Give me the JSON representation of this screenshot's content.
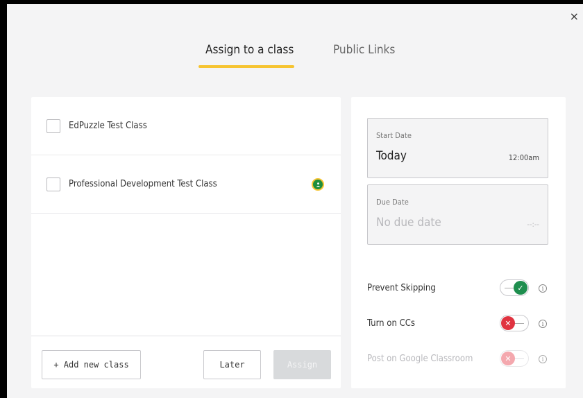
{
  "close_label": "×",
  "tabs": [
    {
      "label": "Assign to a class",
      "active": true
    },
    {
      "label": "Public Links",
      "active": false
    }
  ],
  "classes": [
    {
      "name": "EdPuzzle Test Class",
      "checked": false,
      "google_classroom": false
    },
    {
      "name": "Professional Development Test Class",
      "checked": false,
      "google_classroom": true
    }
  ],
  "buttons": {
    "add_new_class": "+ Add new class",
    "later": "Later",
    "assign": "Assign"
  },
  "start_date": {
    "label": "Start Date",
    "value": "Today",
    "time": "12:00am"
  },
  "due_date": {
    "label": "Due Date",
    "value": "No due date",
    "time": "--:--"
  },
  "settings": [
    {
      "label": "Prevent Skipping",
      "state": "on",
      "enabled": true
    },
    {
      "label": "Turn on CCs",
      "state": "off",
      "enabled": true
    },
    {
      "label": "Post on Google Classroom",
      "state": "off",
      "enabled": false
    }
  ],
  "colors": {
    "accent_underline": "#f6c431",
    "toggle_on": "#1e8e4e",
    "toggle_off": "#e03340",
    "google_classroom_green": "#1e8e3e"
  },
  "icons": {
    "close": "close-icon",
    "google_classroom": "google-classroom-icon",
    "check": "check-icon",
    "x": "x-icon",
    "info": "info-icon"
  }
}
